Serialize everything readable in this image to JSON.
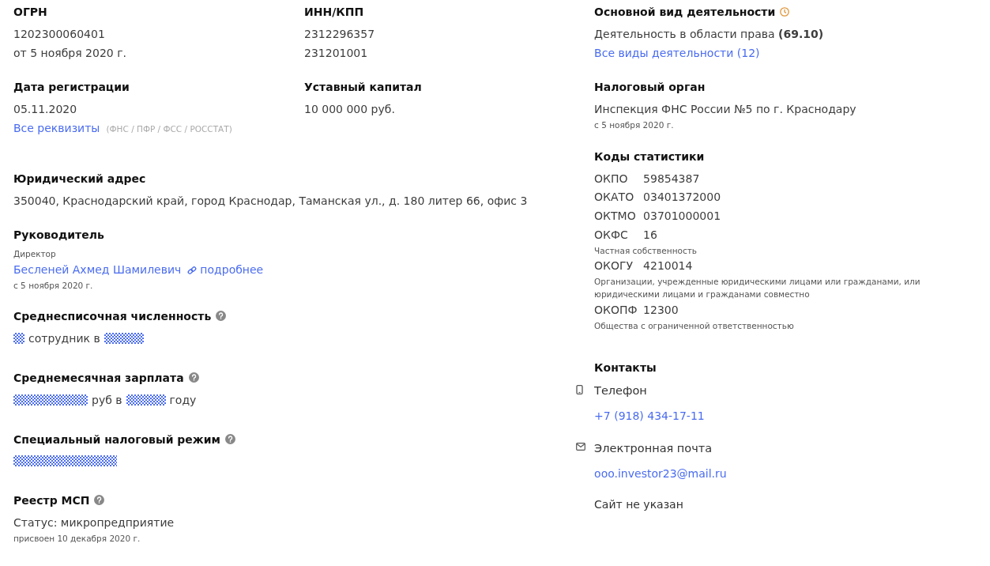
{
  "ogrn": {
    "label": "ОГРН",
    "value": "1202300060401",
    "date": "от 5 ноября 2020 г."
  },
  "inn_kpp": {
    "label": "ИНН/КПП",
    "inn": "2312296357",
    "kpp": "231201001"
  },
  "registration": {
    "label": "Дата регистрации",
    "value": "05.11.2020",
    "link": "Все реквизиты",
    "note": "(ФНС / ПФР / ФСС / РОССТАТ)"
  },
  "capital": {
    "label": "Уставный капитал",
    "value": "10 000 000 руб."
  },
  "address": {
    "label": "Юридический адрес",
    "value": "350040, Краснодарский край, город Краснодар, Таманская ул., д. 180 литер 66, офис 3"
  },
  "director": {
    "label": "Руководитель",
    "role": "Директор",
    "name": "Бесленей Ахмед Шамилевич",
    "more": "подробнее",
    "since": "с 5 ноября 2020 г."
  },
  "hidden_sections": [
    {
      "label": "Среднесписочная численность",
      "help": true,
      "parts": [
        {
          "kind": "mask"
        },
        {
          "kind": "text",
          "text": "сотрудник в"
        },
        {
          "kind": "mask"
        }
      ]
    },
    {
      "label": "Среднемесячная зарплата",
      "help": true,
      "parts": [
        {
          "kind": "mask"
        },
        {
          "kind": "text",
          "text": "руб в"
        },
        {
          "kind": "mask"
        },
        {
          "kind": "text",
          "text": "году"
        }
      ]
    },
    {
      "label": "Специальный налоговый режим",
      "help": true,
      "parts": [
        {
          "kind": "mask"
        }
      ]
    }
  ],
  "msp": {
    "label": "Реестр МСП",
    "help": true,
    "status": "Статус: микропредприятие",
    "assigned": "присвоен 10 декабря 2020 г."
  },
  "activity": {
    "label": "Основной вид деятельности",
    "history": true,
    "main": "Деятельность в области права **(69.10)**",
    "all_link": "Все виды деятельности (12)"
  },
  "tax_authority": {
    "label": "Налоговый орган",
    "value": "Инспекция ФНС России №5 по г. Краснодару",
    "since": "с 5 ноября 2020 г."
  },
  "stat_codes": {
    "label": "Коды статистики",
    "codes": [
      {
        "code": "ОКПО",
        "value": "59854387"
      },
      {
        "code": "ОКАТО",
        "value": "03401372000"
      },
      {
        "code": "ОКТМО",
        "value": "03701000001"
      },
      {
        "code": "ОКФС",
        "value": "16",
        "note": "Частная собственность"
      },
      {
        "code": "ОКОГУ",
        "value": "4210014",
        "note": "Организации, учрежденные юридическими лицами или гражданами, или юридическими лицами и гражданами совместно"
      },
      {
        "code": "ОКОПФ",
        "value": "12300",
        "note": "Общества с ограниченной ответственностью"
      }
    ]
  },
  "contacts": {
    "label": "Контакты",
    "items": [
      {
        "kind": "phone",
        "label": "Телефон",
        "value": "+7 (918) 434-17-11"
      },
      {
        "kind": "email",
        "label": "Электронная почта",
        "value": "ooo.investor23@mail.ru"
      }
    ],
    "website": "Сайт не указан"
  }
}
